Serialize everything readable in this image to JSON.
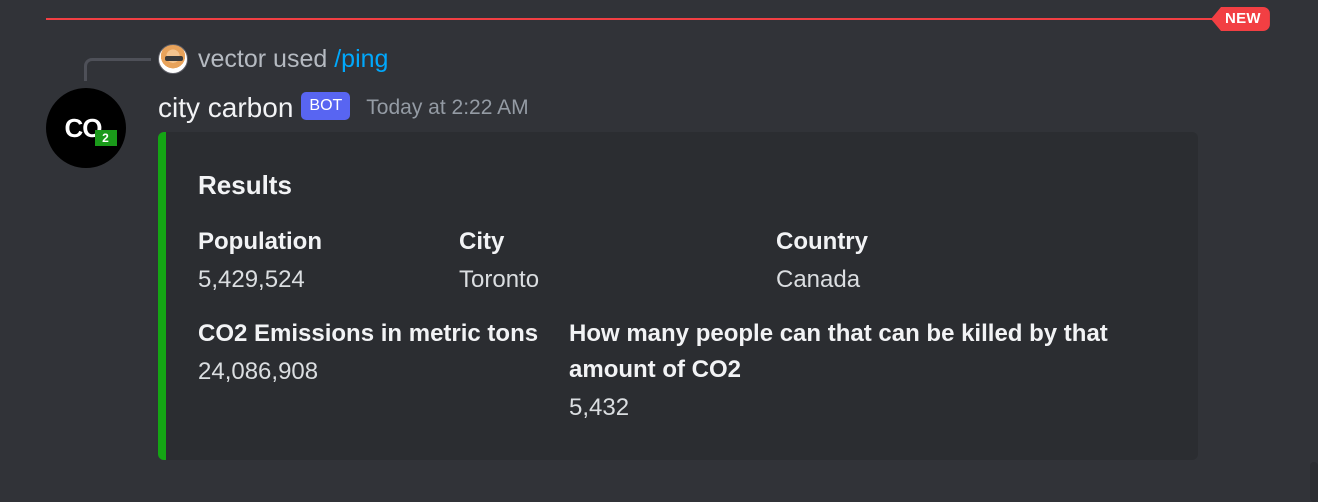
{
  "divider": {
    "badge": "NEW"
  },
  "reply": {
    "username": "vector",
    "action": "used",
    "command": "/ping"
  },
  "message": {
    "avatar_text": "CO",
    "avatar_sub": "2",
    "username": "city carbon",
    "badge": "BOT",
    "timestamp": "Today at 2:22 AM"
  },
  "embed": {
    "accent_color": "#14a514",
    "title": "Results",
    "fields": [
      {
        "name": "Population",
        "value": "5,429,524"
      },
      {
        "name": "City",
        "value": "Toronto"
      },
      {
        "name": "Country",
        "value": "Canada"
      },
      {
        "name": "CO2 Emissions in metric tons",
        "value": "24,086,908"
      },
      {
        "name": "How many people can that can be killed by that amount of CO2",
        "value": "5,432"
      }
    ]
  },
  "colors": {
    "background": "#313338",
    "new_divider": "#f23f43",
    "bot_badge": "#5865f2",
    "command_link": "#00a8fc"
  }
}
